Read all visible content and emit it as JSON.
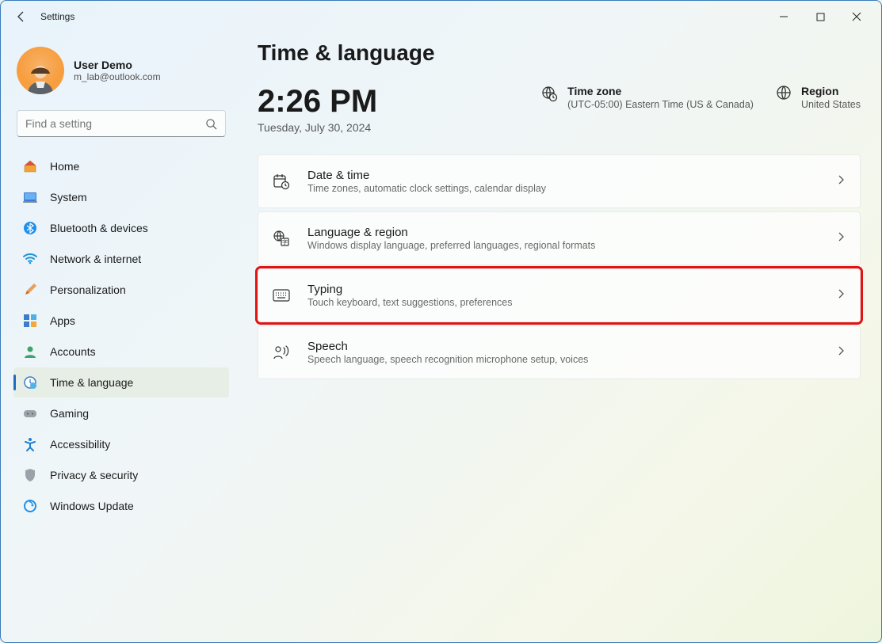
{
  "app": {
    "title": "Settings"
  },
  "profile": {
    "name": "User Demo",
    "email": "m_lab@outlook.com"
  },
  "search": {
    "placeholder": "Find a setting"
  },
  "nav": {
    "items": [
      {
        "label": "Home"
      },
      {
        "label": "System"
      },
      {
        "label": "Bluetooth & devices"
      },
      {
        "label": "Network & internet"
      },
      {
        "label": "Personalization"
      },
      {
        "label": "Apps"
      },
      {
        "label": "Accounts"
      },
      {
        "label": "Time & language"
      },
      {
        "label": "Gaming"
      },
      {
        "label": "Accessibility"
      },
      {
        "label": "Privacy & security"
      },
      {
        "label": "Windows Update"
      }
    ],
    "active_index": 7
  },
  "page": {
    "title": "Time & language",
    "clock": {
      "time": "2:26 PM",
      "date": "Tuesday, July 30, 2024"
    },
    "timezone": {
      "label": "Time zone",
      "value": "(UTC-05:00) Eastern Time (US & Canada)"
    },
    "region": {
      "label": "Region",
      "value": "United States"
    },
    "cards": [
      {
        "title": "Date & time",
        "sub": "Time zones, automatic clock settings, calendar display"
      },
      {
        "title": "Language & region",
        "sub": "Windows display language, preferred languages, regional formats"
      },
      {
        "title": "Typing",
        "sub": "Touch keyboard, text suggestions, preferences"
      },
      {
        "title": "Speech",
        "sub": "Speech language, speech recognition microphone setup, voices"
      }
    ],
    "highlight_index": 2
  }
}
